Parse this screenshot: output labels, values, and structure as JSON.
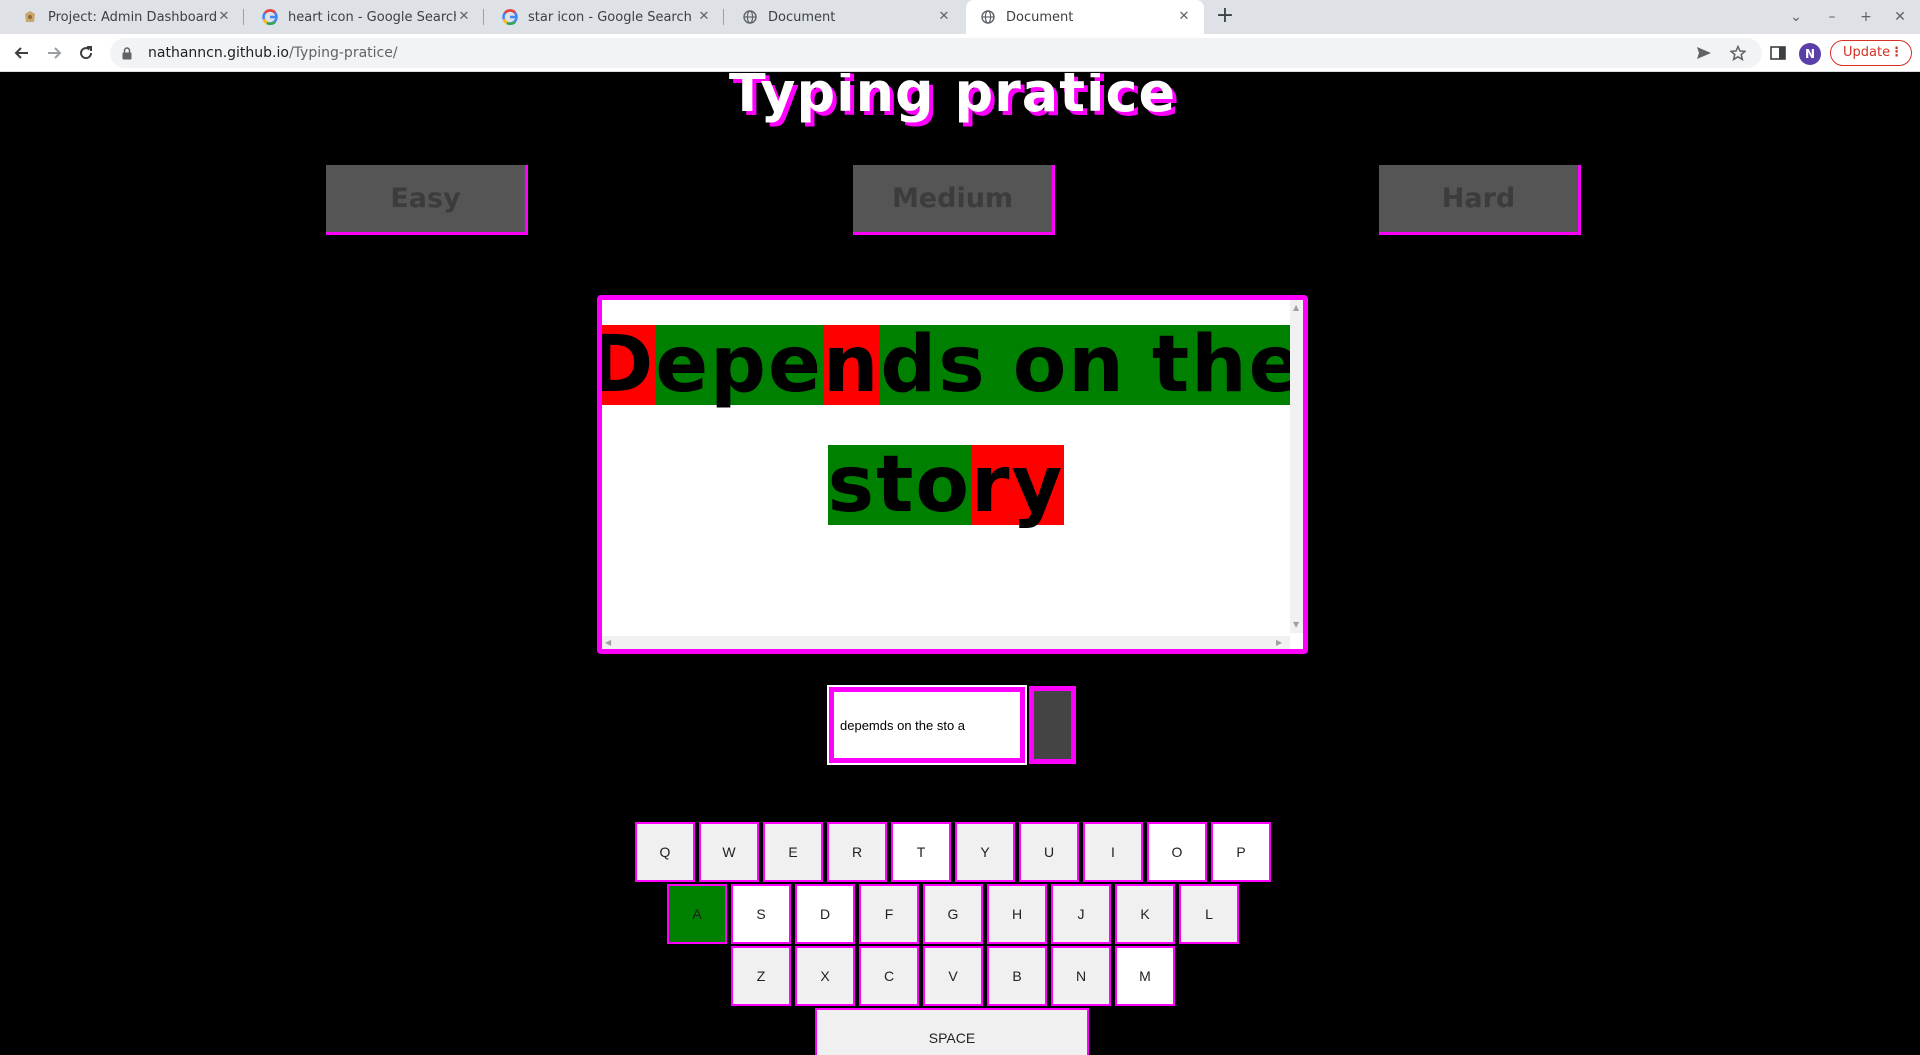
{
  "browser": {
    "tabs": [
      {
        "title": "Project: Admin Dashboard | Th",
        "favicon": "odin-icon",
        "active": false
      },
      {
        "title": "heart icon - Google Search",
        "favicon": "google-icon",
        "active": false
      },
      {
        "title": "star icon - Google Search",
        "favicon": "google-icon",
        "active": false
      },
      {
        "title": "Document",
        "favicon": "globe-icon",
        "active": false
      },
      {
        "title": "Document",
        "favicon": "globe-icon",
        "active": true
      }
    ],
    "url_host": "nathanncn.github.io",
    "url_path": "/Typing-pratice/",
    "avatar_letter": "N",
    "update_label": "Update"
  },
  "page": {
    "title": "Typing pratice",
    "difficulty_buttons": [
      "Easy",
      "Medium",
      "Hard"
    ],
    "target_text": {
      "lines": [
        [
          {
            "c": "D",
            "s": "bad"
          },
          {
            "c": "e",
            "s": "ok"
          },
          {
            "c": "p",
            "s": "ok"
          },
          {
            "c": "e",
            "s": "ok"
          },
          {
            "c": "n",
            "s": "bad"
          },
          {
            "c": "d",
            "s": "ok"
          },
          {
            "c": "s",
            "s": "ok"
          },
          {
            "c": " ",
            "s": "ok"
          },
          {
            "c": "o",
            "s": "ok"
          },
          {
            "c": "n",
            "s": "ok"
          },
          {
            "c": " ",
            "s": "ok"
          },
          {
            "c": "t",
            "s": "ok"
          },
          {
            "c": "h",
            "s": "ok"
          },
          {
            "c": "e",
            "s": "ok"
          }
        ],
        [
          {
            "c": "s",
            "s": "ok"
          },
          {
            "c": "t",
            "s": "ok"
          },
          {
            "c": "o",
            "s": "ok"
          },
          {
            "c": "r",
            "s": "bad"
          },
          {
            "c": "y",
            "s": "bad"
          }
        ]
      ]
    },
    "typed_value": "depemds on the sto a",
    "keyboard": {
      "row1": [
        "Q",
        "W",
        "E",
        "R",
        "T",
        "Y",
        "U",
        "I",
        "O",
        "P"
      ],
      "row2": [
        "A",
        "S",
        "D",
        "F",
        "G",
        "H",
        "J",
        "K",
        "L"
      ],
      "row3": [
        "Z",
        "X",
        "C",
        "V",
        "B",
        "N",
        "M"
      ],
      "space": "SPACE",
      "highlighted": "A",
      "white_keys": [
        "T",
        "O",
        "P",
        "S",
        "D",
        "M"
      ]
    },
    "colors": {
      "accent": "#ff00ff",
      "correct": "#008000",
      "incorrect": "#ff0000"
    }
  }
}
